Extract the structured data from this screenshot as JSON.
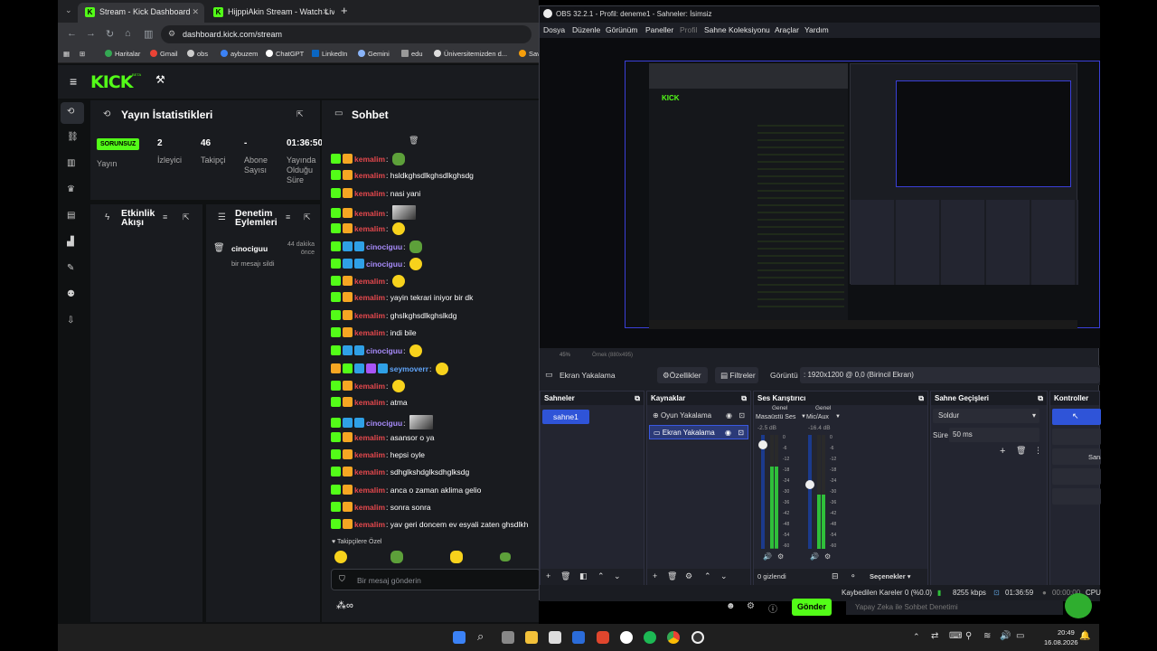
{
  "browser": {
    "tabs": [
      {
        "label": "Stream - Kick Dashboard",
        "favicon": "K"
      },
      {
        "label": "HijppiAkin Stream - Watch Live",
        "favicon": "K"
      }
    ],
    "new_tab": "+",
    "url": "dashboard.kick.com/stream",
    "bookmarks": [
      "Haritalar",
      "Gmail",
      "obs",
      "aybuzem",
      "ChatGPT",
      "LinkedIn",
      "Gemini",
      "edu",
      "Üniversitemizden d...",
      "Sav"
    ]
  },
  "kick": {
    "logo": "KICK",
    "logo_sup": "BETA",
    "stats_panel": {
      "title": "Yayın İstatistikleri",
      "status_badge": "SORUNSUZ",
      "status_label": "Yayın",
      "viewers": {
        "value": "2",
        "label": "İzleyici"
      },
      "followers": {
        "value": "46",
        "label": "Takipçi"
      },
      "subs": {
        "value": "-",
        "label": "Abone Sayısı"
      },
      "uptime": {
        "value": "01:36:50",
        "label": "Yayında Olduğu Süre"
      }
    },
    "activity_panel": {
      "title": "Etkinlik Akışı"
    },
    "mod_panel": {
      "title": "Denetim Eylemleri",
      "entry_user": "cinociguu",
      "entry_time": "44 dakika önce",
      "entry_action": "bir mesajı sildi"
    },
    "chat": {
      "title": "Sohbet",
      "messages": [
        {
          "user": "kemalim",
          "text": "",
          "emote": "frog",
          "color": "#e5484d",
          "badges": "gy"
        },
        {
          "user": "kemalim",
          "text": "hsldkghsdlkghsdlkghsdg",
          "emote": "",
          "color": "#e5484d",
          "badges": "gy"
        },
        {
          "user": "kemalim",
          "text": "nasi yani",
          "emote": "",
          "color": "#e5484d",
          "badges": "gy"
        },
        {
          "user": "kemalim",
          "text": "",
          "emote": "img",
          "color": "#e5484d",
          "badges": "gy"
        },
        {
          "user": "kemalim",
          "text": "",
          "emote": "face",
          "color": "#e5484d",
          "badges": "gy"
        },
        {
          "user": "cinociguu",
          "text": "",
          "emote": "frog",
          "color": "#a78bfa",
          "badges": "gbb"
        },
        {
          "user": "cinociguu",
          "text": "",
          "emote": "face",
          "color": "#a78bfa",
          "badges": "gbb"
        },
        {
          "user": "kemalim",
          "text": "",
          "emote": "face",
          "color": "#e5484d",
          "badges": "gy"
        },
        {
          "user": "kemalim",
          "text": "yayin tekrari iniyor bir dk",
          "emote": "",
          "color": "#e5484d",
          "badges": "gy"
        },
        {
          "user": "kemalim",
          "text": "ghslkghsdlkghslkdg",
          "emote": "",
          "color": "#e5484d",
          "badges": "gy"
        },
        {
          "user": "kemalim",
          "text": "indi bile",
          "emote": "",
          "color": "#e5484d",
          "badges": "gy"
        },
        {
          "user": "cinociguu",
          "text": "",
          "emote": "face",
          "color": "#a78bfa",
          "badges": "gbb"
        },
        {
          "user": "seymoverr",
          "text": "",
          "emote": "face",
          "color": "#60a5fa",
          "badges": "ygbpb"
        },
        {
          "user": "kemalim",
          "text": "",
          "emote": "face",
          "color": "#e5484d",
          "badges": "gy"
        },
        {
          "user": "kemalim",
          "text": "atma",
          "emote": "",
          "color": "#e5484d",
          "badges": "gy"
        },
        {
          "user": "cinociguu",
          "text": "",
          "emote": "img",
          "color": "#a78bfa",
          "badges": "gbb"
        },
        {
          "user": "kemalim",
          "text": "asansor o ya",
          "emote": "",
          "color": "#e5484d",
          "badges": "gy"
        },
        {
          "user": "kemalim",
          "text": "hepsi oyle",
          "emote": "",
          "color": "#e5484d",
          "badges": "gy"
        },
        {
          "user": "kemalim",
          "text": "sdhglkshdglksdhglksdg",
          "emote": "",
          "color": "#e5484d",
          "badges": "gy"
        },
        {
          "user": "kemalim",
          "text": "anca o zaman aklima gelio",
          "emote": "",
          "color": "#e5484d",
          "badges": "gy"
        },
        {
          "user": "kemalim",
          "text": "sonra sonra",
          "emote": "",
          "color": "#e5484d",
          "badges": "gy"
        },
        {
          "user": "kemalim",
          "text": "yav geri doncem ev esyali zaten ghsdlkh",
          "emote": "",
          "color": "#e5484d",
          "badges": "gy"
        }
      ],
      "followers_only": "Takipçilere Özel",
      "input_placeholder": "Bir mesaj gönderin",
      "send_label": "Gönder",
      "ai_hint": "Yapay Zeka ile Sohbet Denetimi"
    }
  },
  "obs": {
    "title": "OBS 32.2.1 - Profil: deneme1 - Sahneler: İsimsiz",
    "menu": [
      "Dosya",
      "Düzenle",
      "Görünüm",
      "Paneller",
      "Profil",
      "Sahne Koleksiyonu",
      "Araçlar",
      "Yardım"
    ],
    "zoom": "45%",
    "preview_label": "Örnek (880x495)",
    "source_bar": {
      "source": "Ekran Yakalama",
      "properties": "Özellikler",
      "filters": "Filtreler",
      "display_label": "Görüntü",
      "display_value": ": 1920x1200 @ 0,0 (Birincil Ekran)"
    },
    "scenes": {
      "title": "Sahneler",
      "items": [
        "sahne1"
      ]
    },
    "sources": {
      "title": "Kaynaklar",
      "items": [
        "Oyun Yakalama",
        "Ekran Yakalama"
      ]
    },
    "mixer": {
      "title": "Ses Karıştırıcı",
      "channels": [
        {
          "tag": "Genel",
          "name": "Masaüstü Ses",
          "db": "-2.5 dB",
          "level": 0.72
        },
        {
          "tag": "Genel",
          "name": "Mic/Aux",
          "db": "-16.4 dB",
          "level": 0.48
        }
      ],
      "ticks": [
        "0",
        "-6",
        "-12",
        "-18",
        "-24",
        "-30",
        "-36",
        "-42",
        "-48",
        "-54",
        "-60"
      ],
      "hidden": "0 gizlendi",
      "options": "Seçenekler"
    },
    "transitions": {
      "title": "Sahne Geçişleri",
      "type": "Soldur",
      "duration_label": "Süre",
      "duration": "50 ms"
    },
    "controls": {
      "title": "Kontroller",
      "virtual_cam": "Sanal K"
    },
    "status": {
      "dropped": "Kaybedilen Kareler 0 (%0.0)",
      "bitrate": "8255 kbps",
      "time": "01:36:59",
      "rec_time": "00:00:00",
      "cpu": "CPU"
    }
  },
  "taskbar": {
    "time": "20:49",
    "date": "16.08.2026"
  }
}
